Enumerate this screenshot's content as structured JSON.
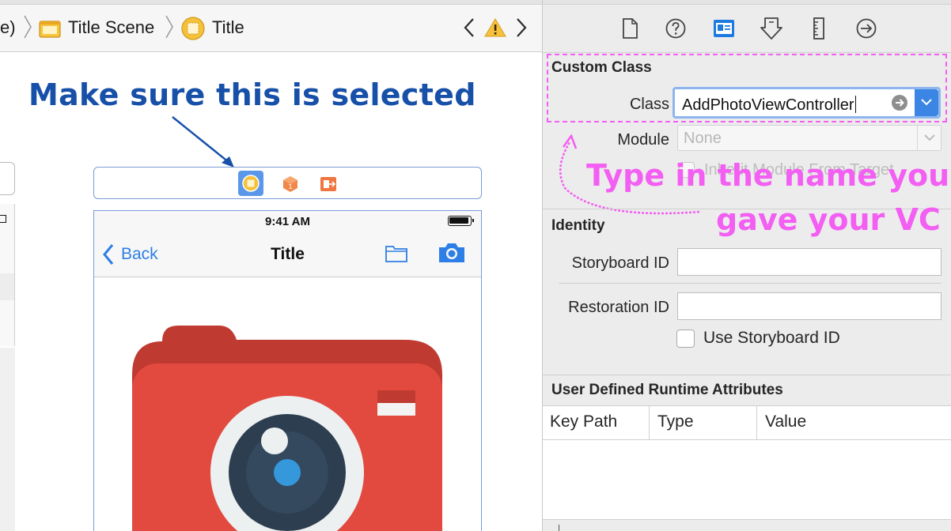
{
  "breadcrumb": {
    "items": [
      {
        "label": "e)"
      },
      {
        "label": "Title Scene"
      },
      {
        "label": "Title"
      }
    ]
  },
  "canvas": {
    "annotation": "Make sure this is selected",
    "status_time": "9:41 AM",
    "nav_back_label": "Back",
    "nav_title": "Title"
  },
  "inspector": {
    "toolbar_icons": [
      "file-inspector-icon",
      "quick-help-icon",
      "identity-inspector-icon",
      "attributes-inspector-icon",
      "size-inspector-icon",
      "connections-inspector-icon"
    ],
    "custom_class": {
      "title": "Custom Class",
      "class_label": "Class",
      "class_value": "AddPhotoViewController",
      "module_label": "Module",
      "module_placeholder": "None",
      "inherit_label": "Inherit Module From Target"
    },
    "annotation_line1": "Type in the name you",
    "annotation_line2": "gave your VC",
    "identity": {
      "title": "Identity",
      "storyboard_id_label": "Storyboard ID",
      "storyboard_id_value": "",
      "restoration_id_label": "Restoration ID",
      "restoration_id_value": "",
      "use_storyboard_id_label": "Use Storyboard ID"
    },
    "udra": {
      "title": "User Defined Runtime Attributes",
      "columns": [
        "Key Path",
        "Type",
        "Value"
      ]
    }
  },
  "colors": {
    "annotation_blue": "#1750a8",
    "annotation_pink": "#f25ff2",
    "ios_blue": "#2d7ee6",
    "camera_red": "#e24a3f"
  }
}
